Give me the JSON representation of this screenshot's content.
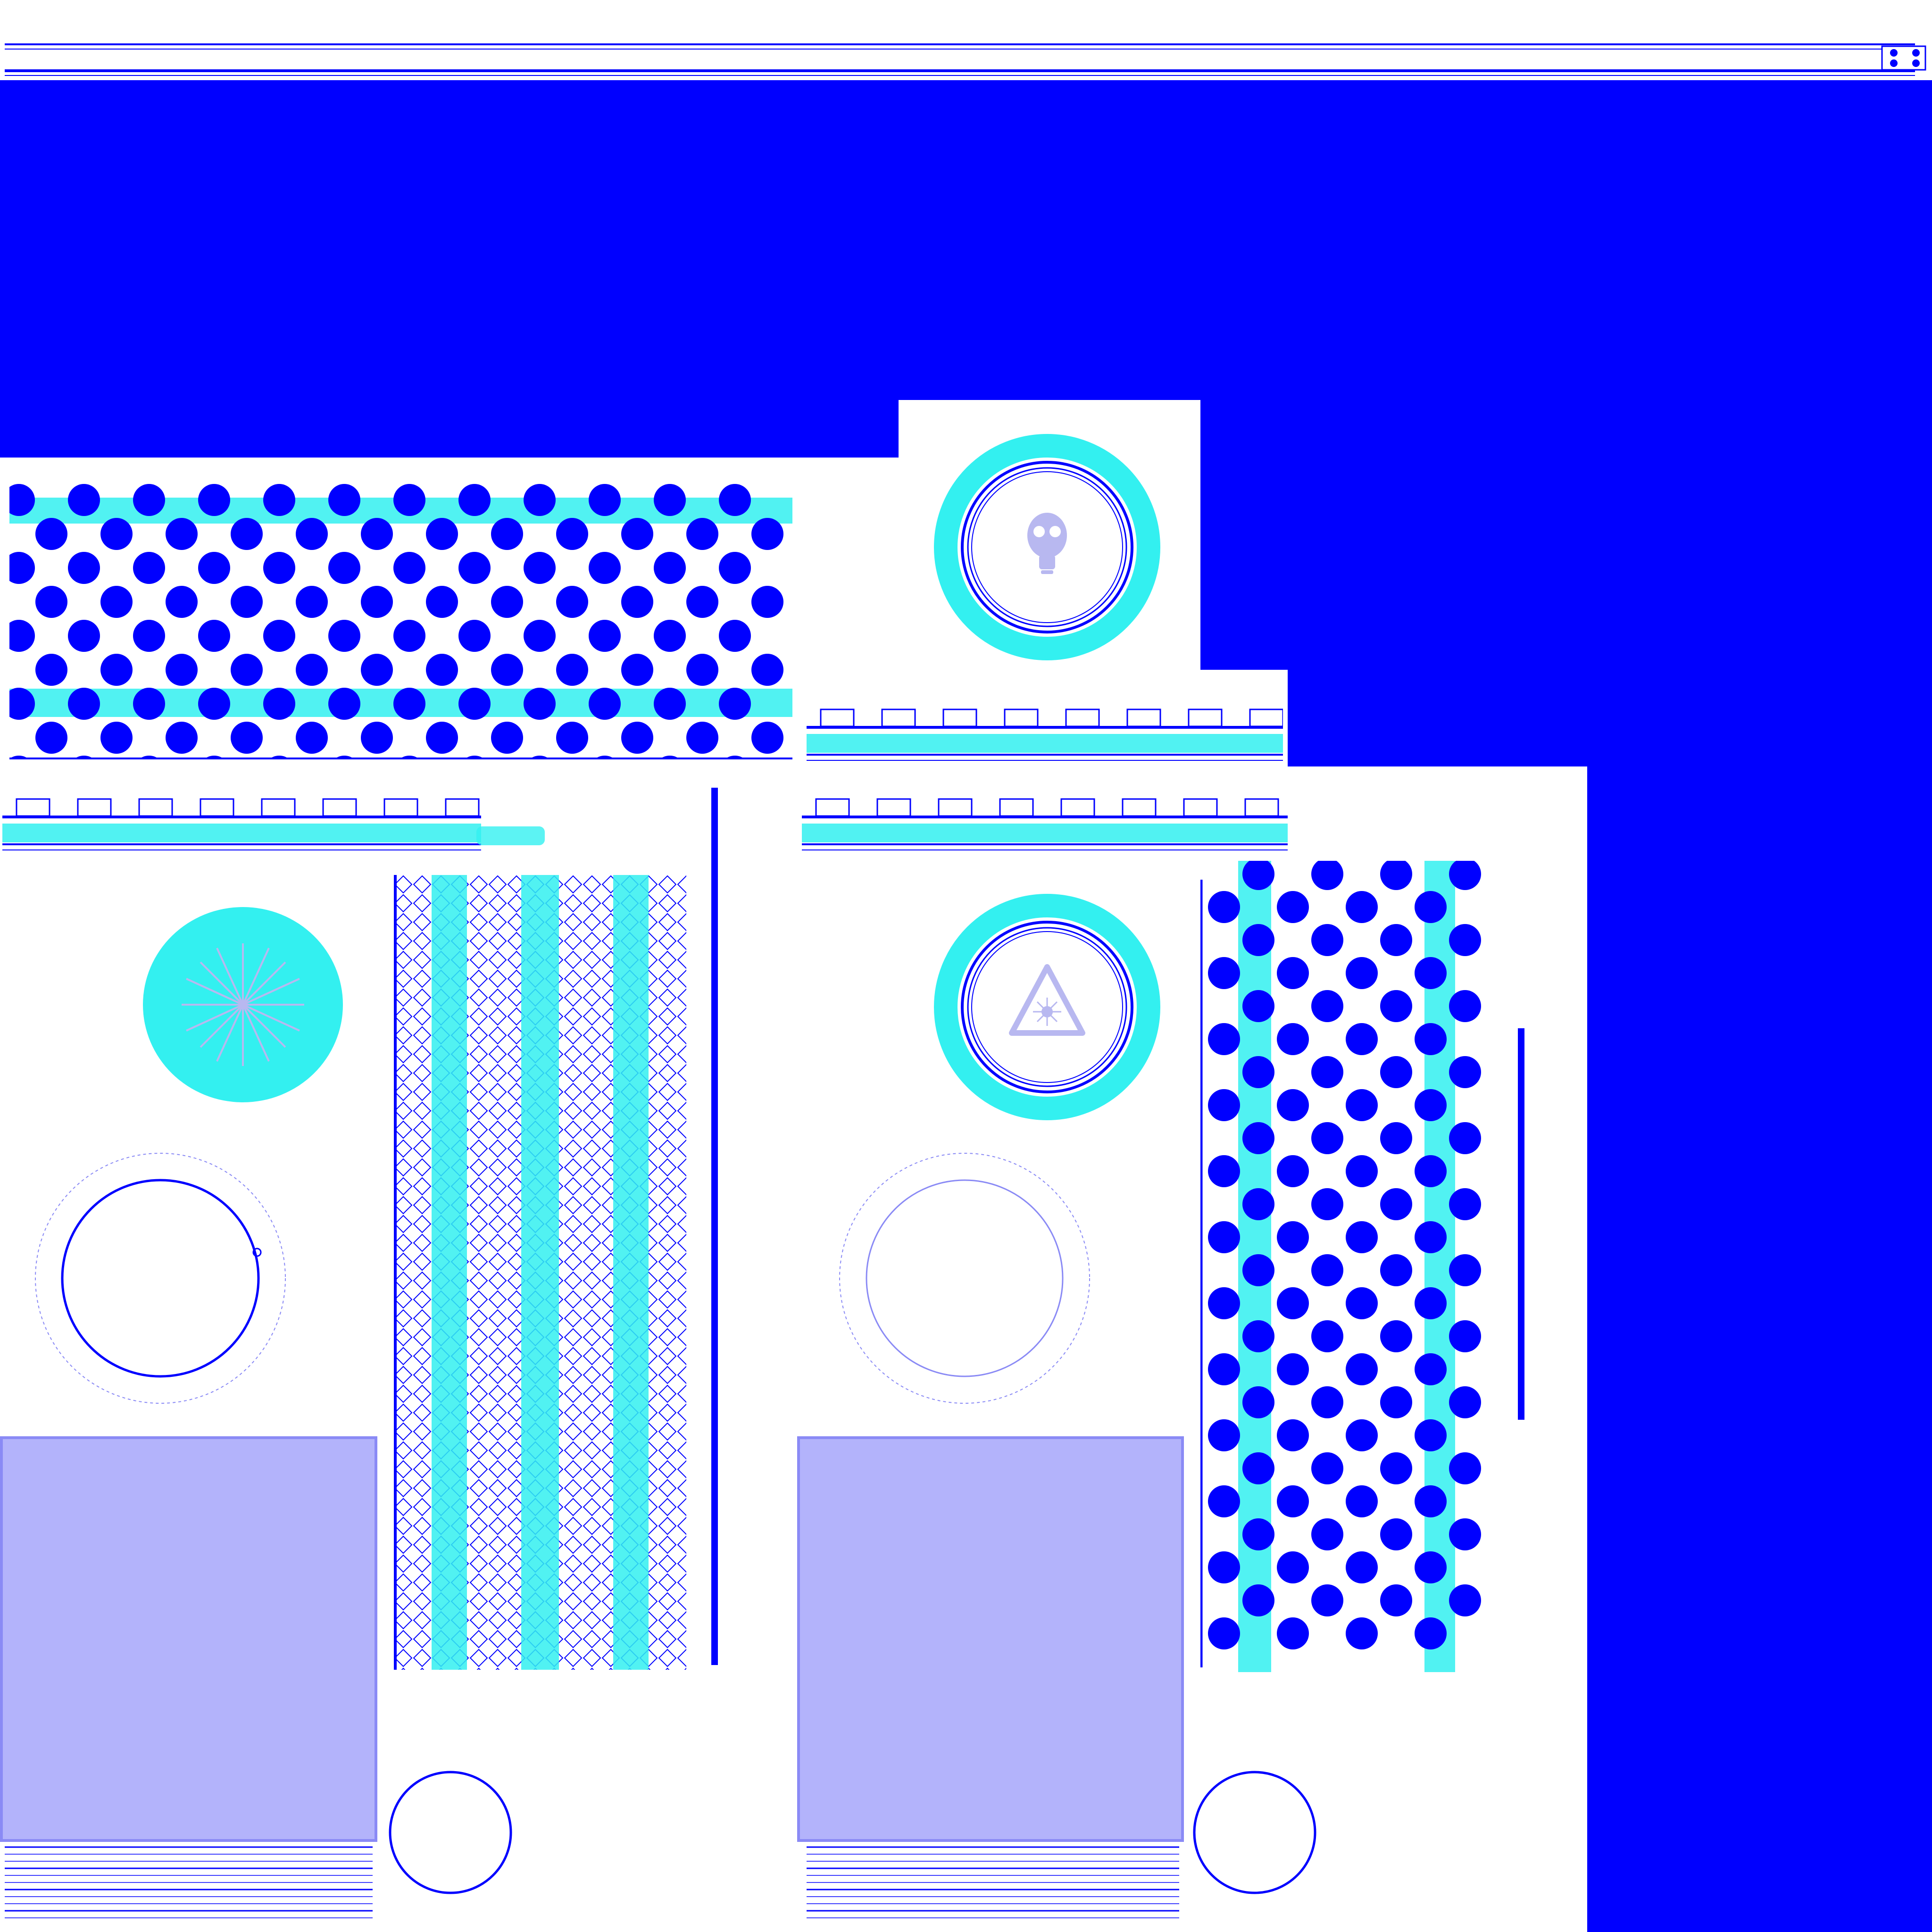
{
  "palette": {
    "blue": "#0000ff",
    "cyan": "#33f0f0",
    "white": "#ffffff",
    "lavender": "#b3b3fb",
    "lavender_border": "#8a8af5",
    "symbol": "#b8b8f0"
  },
  "icons": {
    "gas_mask": "gas-mask-icon",
    "laser_warning": "laser-warning-icon",
    "starburst": "starburst-icon",
    "screw": "screw-icon"
  },
  "panels": [
    {
      "id": "top-strip",
      "kind": "rail"
    },
    {
      "id": "left-perforated-band",
      "kind": "dot-grid"
    },
    {
      "id": "gas-mask-badge",
      "kind": "round-badge"
    },
    {
      "id": "left-rails",
      "kind": "rail"
    },
    {
      "id": "mid-rails",
      "kind": "rail"
    },
    {
      "id": "starburst-disc",
      "kind": "round-badge"
    },
    {
      "id": "diamond-mesh-column",
      "kind": "mesh"
    },
    {
      "id": "laser-badge",
      "kind": "round-badge"
    },
    {
      "id": "right-perforated-column",
      "kind": "dot-grid"
    },
    {
      "id": "left-lavender-plate",
      "kind": "plate"
    },
    {
      "id": "right-lavender-plate",
      "kind": "plate"
    }
  ]
}
